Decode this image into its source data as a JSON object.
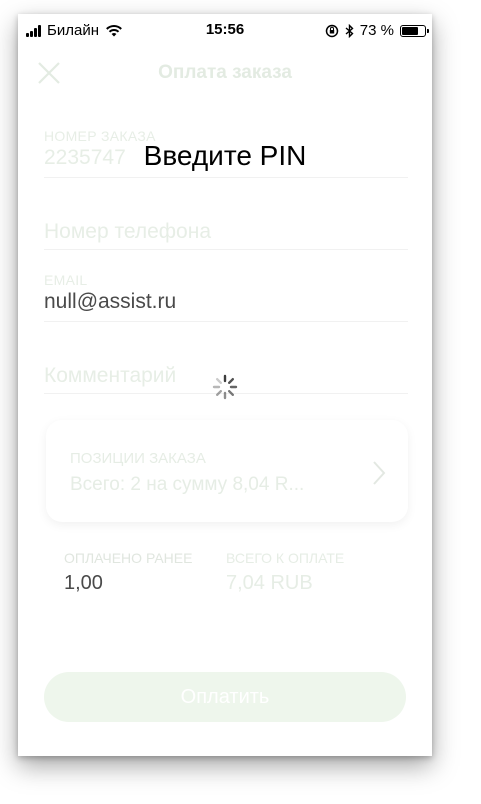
{
  "status_bar": {
    "carrier": "Билайн",
    "time": "15:56",
    "battery_percent": "73 %",
    "battery_level": 0.73
  },
  "nav": {
    "title": "Оплата заказа"
  },
  "form": {
    "order_number_label": "НОМЕР ЗАКАЗА",
    "order_number_value": "2235747",
    "phone_placeholder": "Номер телефона",
    "email_label": "EMAIL",
    "email_value": "null@assist.ru",
    "comment_placeholder": "Комментарий"
  },
  "order_card": {
    "label": "ПОЗИЦИИ ЗАКАЗА",
    "summary": "Всего: 2 на сумму 8,04 R..."
  },
  "totals": {
    "paid_label": "ОПЛАЧЕНО РАНЕЕ",
    "paid_value": "1,00",
    "total_label": "ВСЕГО К ОПЛАТЕ",
    "total_value": "7,04 RUB"
  },
  "pay_button_label": "Оплатить",
  "pin_overlay": {
    "title": "Введите PIN"
  },
  "colors": {
    "accent_faded": "#e6ede5",
    "button_bg": "#eef6ec"
  }
}
